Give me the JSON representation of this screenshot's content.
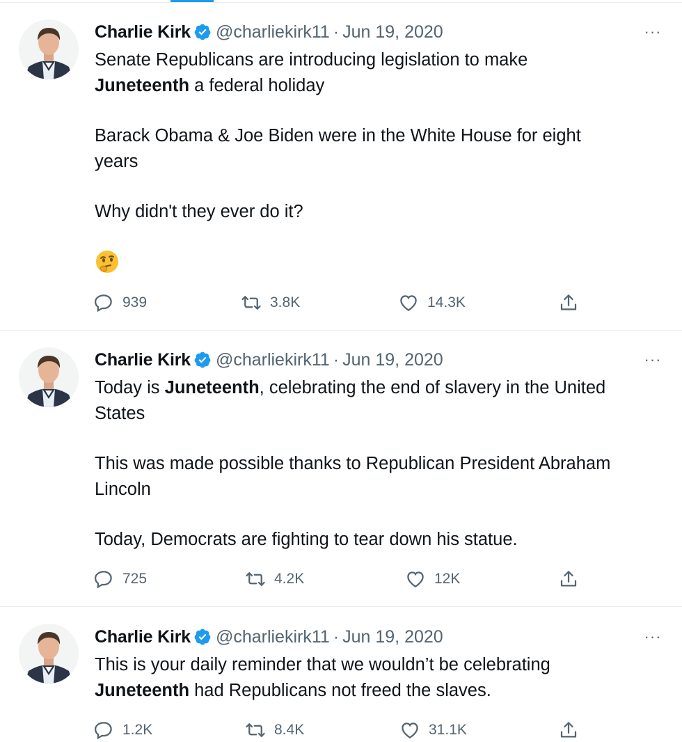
{
  "tweets": [
    {
      "author": "Charlie Kirk",
      "handle": "@charliekirk11",
      "separator": "·",
      "date": "Jun 19, 2020",
      "more": "···",
      "line1": "Senate Republicans are introducing legislation to make",
      "line2_bold": "Juneteenth",
      "line2_rest": " a federal holiday",
      "para2_line1": "Barack Obama & Joe Biden were in the White House for eight",
      "para2_line2": "years",
      "para3": "Why didn't they ever do it?",
      "emoji": "thinking-face",
      "replies": "939",
      "retweets": "3.8K",
      "likes": "14.3K"
    },
    {
      "author": "Charlie Kirk",
      "handle": "@charliekirk11",
      "separator": "·",
      "date": "Jun 19, 2020",
      "more": "···",
      "line1_pre": "Today is ",
      "line1_bold": "Juneteenth",
      "line1_rest": ", celebrating the end of slavery in the United",
      "line2": "States",
      "para2_line1": "This was made possible thanks to Republican President Abraham",
      "para2_line2": "Lincoln",
      "para3": "Today, Democrats are fighting to tear down his statue.",
      "replies": "725",
      "retweets": "4.2K",
      "likes": "12K"
    },
    {
      "author": "Charlie Kirk",
      "handle": "@charliekirk11",
      "separator": "·",
      "date": "Jun 19, 2020",
      "more": "···",
      "line1": "This is your daily reminder that we wouldn’t be celebrating",
      "line2_bold": "Juneteenth",
      "line2_rest": " had Republicans not freed the slaves.",
      "replies": "1.2K",
      "retweets": "8.4K",
      "likes": "31.1K"
    }
  ],
  "icons": {
    "verified": "verified-badge-icon",
    "reply": "reply-icon",
    "retweet": "retweet-icon",
    "like": "heart-icon",
    "share": "share-icon"
  },
  "colors": {
    "verified_blue": "#1d9bf0",
    "text": "#0f1419",
    "secondary_text": "#536471",
    "divider": "#e6ecf0"
  }
}
